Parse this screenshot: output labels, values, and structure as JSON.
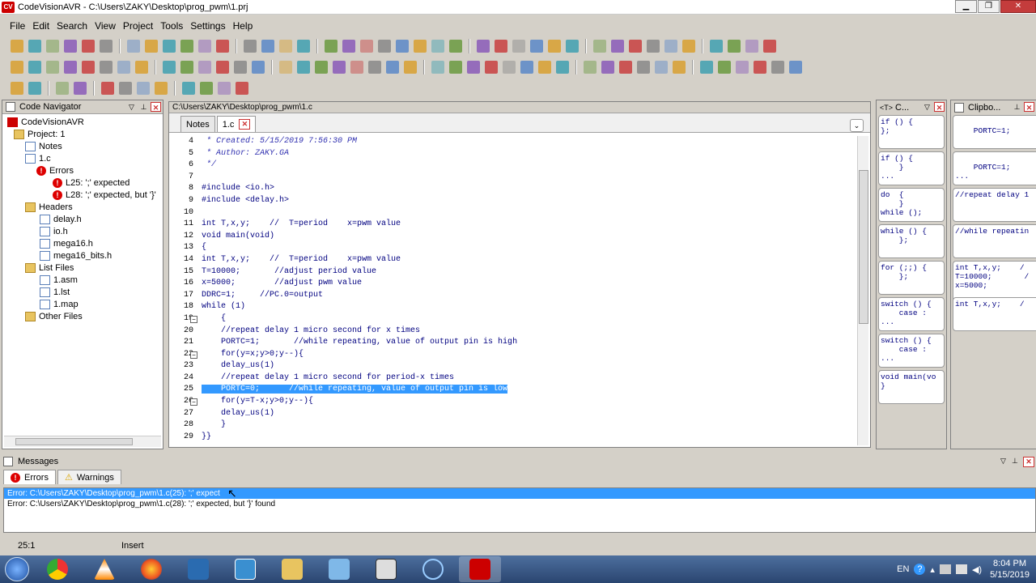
{
  "window": {
    "title": "CodeVisionAVR - C:\\Users\\ZAKY\\Desktop\\prog_pwm\\1.prj",
    "logo": "CV"
  },
  "menu": [
    "File",
    "Edit",
    "Search",
    "View",
    "Project",
    "Tools",
    "Settings",
    "Help"
  ],
  "navigator": {
    "title": "Code Navigator",
    "items": [
      {
        "label": "CodeVisionAVR",
        "icon": "cv-logo-icon"
      },
      {
        "label": "Project: 1",
        "icon": "project-icon"
      },
      {
        "label": "Notes",
        "icon": "notes-icon"
      },
      {
        "label": "1.c",
        "icon": "c-file-icon"
      },
      {
        "label": "Errors",
        "icon": "error-icon"
      },
      {
        "label": "L25: ';' expected",
        "icon": "error-icon"
      },
      {
        "label": "L28: ';' expected, but '}'",
        "icon": "error-icon"
      },
      {
        "label": "Headers",
        "icon": "folder-icon"
      },
      {
        "label": "delay.h",
        "icon": "file-icon"
      },
      {
        "label": "io.h",
        "icon": "file-icon"
      },
      {
        "label": "mega16.h",
        "icon": "file-icon"
      },
      {
        "label": "mega16_bits.h",
        "icon": "file-icon"
      },
      {
        "label": "List Files",
        "icon": "folder-icon"
      },
      {
        "label": "1.asm",
        "icon": "file-icon"
      },
      {
        "label": "1.lst",
        "icon": "file-icon"
      },
      {
        "label": "1.map",
        "icon": "file-icon"
      },
      {
        "label": "Other Files",
        "icon": "folder-icon"
      }
    ]
  },
  "editor": {
    "path": "C:\\Users\\ZAKY\\Desktop\\prog_pwm\\1.c",
    "tabs": [
      "Notes",
      "1.c"
    ],
    "lines": [
      {
        "n": "4",
        "t": " * Created: 5/15/2019 7:56:30 PM",
        "c": true
      },
      {
        "n": "5",
        "t": " * Author: ZAKY.GA",
        "c": true
      },
      {
        "n": "6",
        "t": " */",
        "c": true
      },
      {
        "n": "7",
        "t": ""
      },
      {
        "n": "8",
        "t": "#include <io.h>"
      },
      {
        "n": "9",
        "t": "#include <delay.h>"
      },
      {
        "n": "10",
        "t": ""
      },
      {
        "n": "11",
        "t": "int T,x,y;    //  T=period    x=pwm value"
      },
      {
        "n": "12",
        "t": "void main(void)"
      },
      {
        "n": "13",
        "t": "{"
      },
      {
        "n": "14",
        "t": "int T,x,y;    //  T=period    x=pwm value"
      },
      {
        "n": "15",
        "t": "T=10000;       //adjust period value"
      },
      {
        "n": "16",
        "t": "x=5000;        //adjust pwm value"
      },
      {
        "n": "17",
        "t": "DDRC=1;     //PC.0=output"
      },
      {
        "n": "18",
        "t": "while (1)"
      },
      {
        "n": "19",
        "t": "    {"
      },
      {
        "n": "20",
        "t": "    //repeat delay 1 micro second for x times"
      },
      {
        "n": "21",
        "t": "    PORTC=1;       //while repeating, value of output pin is high"
      },
      {
        "n": "22",
        "t": "    for(y=x;y>0;y--){"
      },
      {
        "n": "23",
        "t": "    delay_us(1)"
      },
      {
        "n": "24",
        "t": "    //repeat delay 1 micro second for period-x times"
      },
      {
        "n": "25",
        "t": "    PORTC=0;      //while repeating, value of output pin is low",
        "hl": true
      },
      {
        "n": "26",
        "t": "    for(y=T-x;y>0;y--){"
      },
      {
        "n": "27",
        "t": "    delay_us(1)"
      },
      {
        "n": "28",
        "t": "    }"
      },
      {
        "n": "29",
        "t": "}}"
      }
    ]
  },
  "templates": {
    "title": "C...",
    "items": [
      "if () {\n};",
      "if () {\n    }\n...",
      "do  {\n    }\nwhile ();",
      "while () {\n    };",
      "for (;;) {\n    };",
      "switch () {\n    case :\n...",
      "switch () {\n    case :\n...",
      "void main(vo\n}"
    ]
  },
  "clipboard": {
    "title": "Clipbo...",
    "items": [
      "\n    PORTC=1;",
      "\n    PORTC=1;\n...",
      "//repeat delay 1",
      "//while repeatin",
      "int T,x,y;    /\nT=10000;       /\nx=5000;",
      "int T,x,y;    /"
    ]
  },
  "messages": {
    "title": "Messages",
    "tabs": [
      "Errors",
      "Warnings"
    ],
    "rows": [
      "Error: C:\\Users\\ZAKY\\Desktop\\prog_pwm\\1.c(25): ';' expect",
      "Error: C:\\Users\\ZAKY\\Desktop\\prog_pwm\\1.c(28): ';' expected, but '}' found"
    ]
  },
  "status": {
    "position": "25:1",
    "mode": "Insert"
  },
  "taskbar": {
    "lang": "EN",
    "time": "8:04 PM",
    "date": "5/15/2019"
  },
  "colors": {
    "selection": "#3399ff",
    "code": "#000080",
    "comment": "#3030b0",
    "error": "#dd0000"
  }
}
